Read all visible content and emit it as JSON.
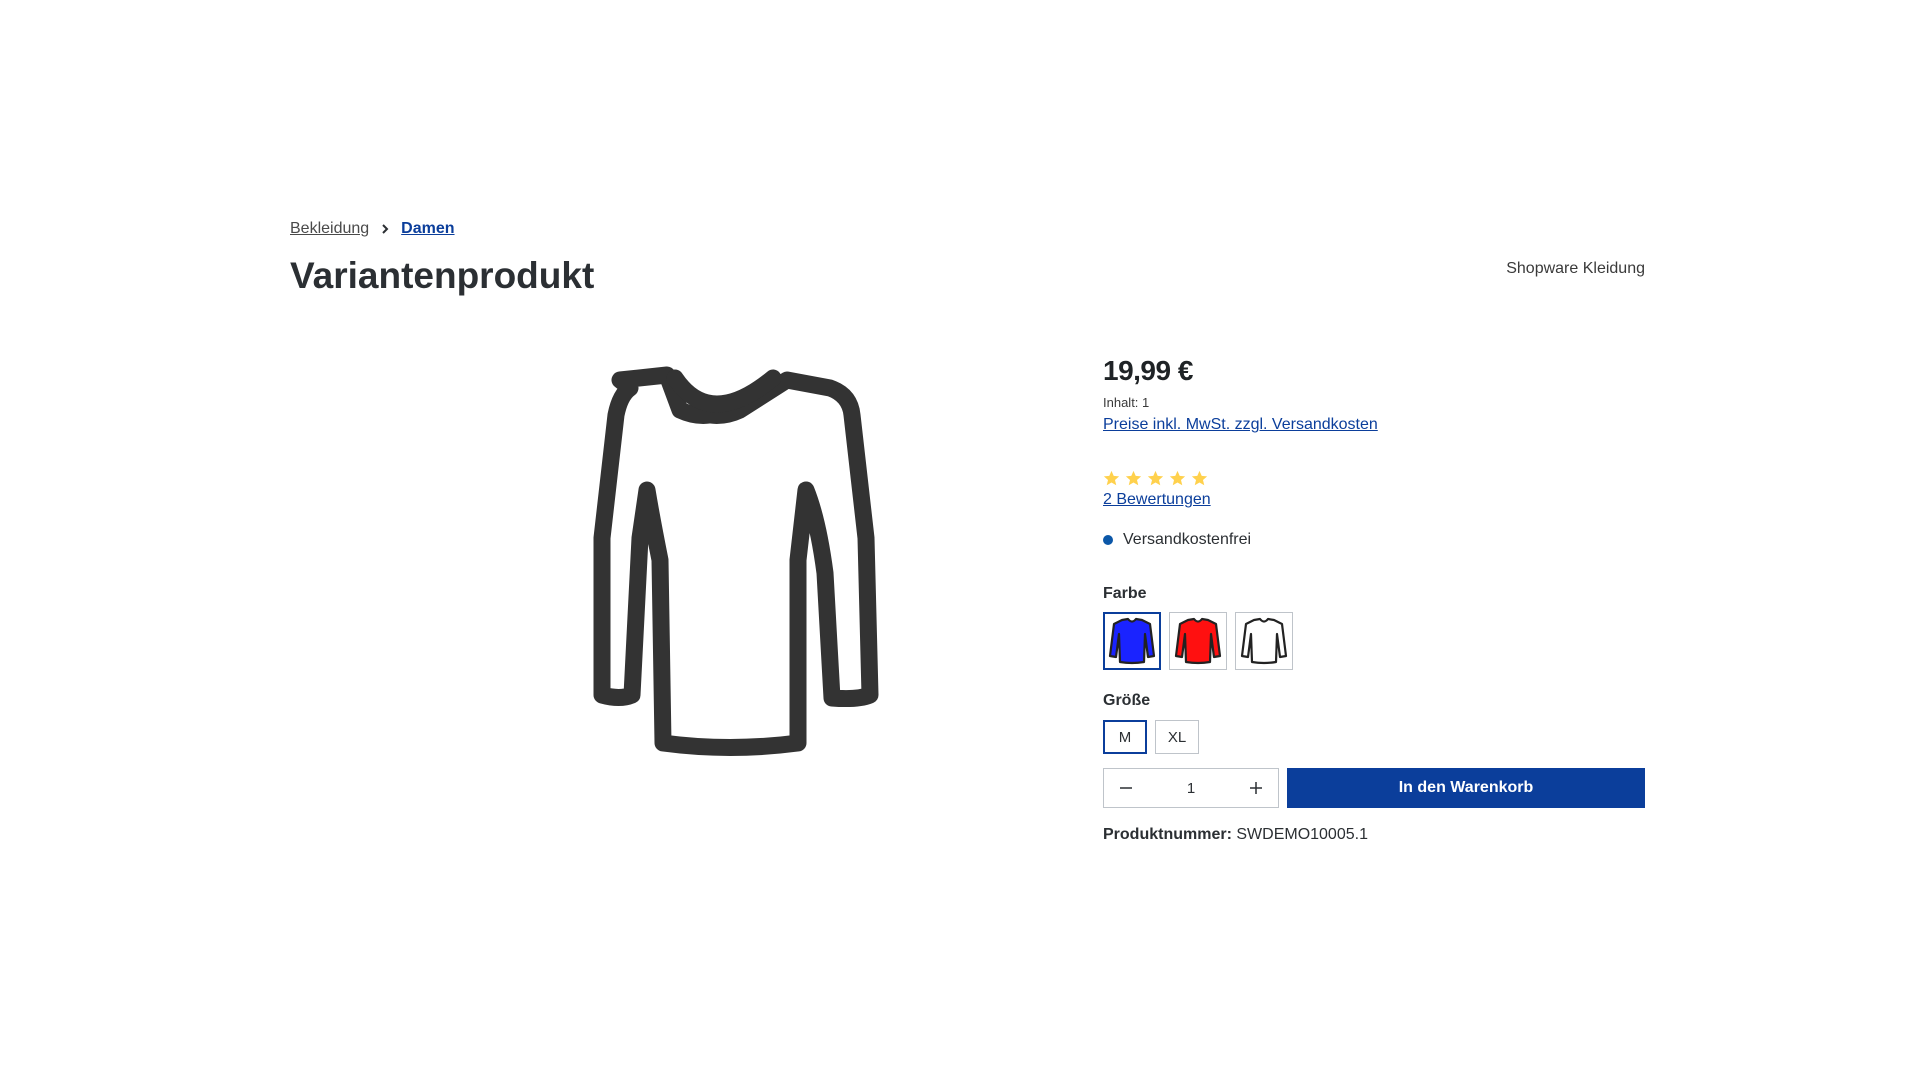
{
  "breadcrumb": {
    "items": [
      {
        "label": "Bekleidung"
      },
      {
        "label": "Damen"
      }
    ]
  },
  "product": {
    "title": "Variantenprodukt",
    "manufacturer": "Shopware Kleidung",
    "price": "19,99 €",
    "content": "Inhalt: 1",
    "tax_link": "Preise inkl. MwSt. zzgl. Versandkosten",
    "rating": 5,
    "rating_max": 5,
    "reviews_link": "2 Bewertungen",
    "delivery": "Versandkostenfrei",
    "product_number_label": "Produktnummer:",
    "product_number": "SWDEMO10005.1"
  },
  "options": {
    "color_label": "Farbe",
    "colors": [
      {
        "name": "blau",
        "fill": "#1a23ff",
        "selected": true
      },
      {
        "name": "rot",
        "fill": "#ff1010",
        "selected": false
      },
      {
        "name": "weiß",
        "fill": "#ffffff",
        "selected": false
      }
    ],
    "size_label": "Größe",
    "sizes": [
      {
        "label": "M",
        "selected": true
      },
      {
        "label": "XL",
        "selected": false
      }
    ]
  },
  "cart": {
    "quantity": "1",
    "add_label": "In den Warenkorb"
  },
  "colors": {
    "brand": "#0b3e9b",
    "star": "#ffd14d",
    "delivery_dot": "#0b57a8"
  }
}
